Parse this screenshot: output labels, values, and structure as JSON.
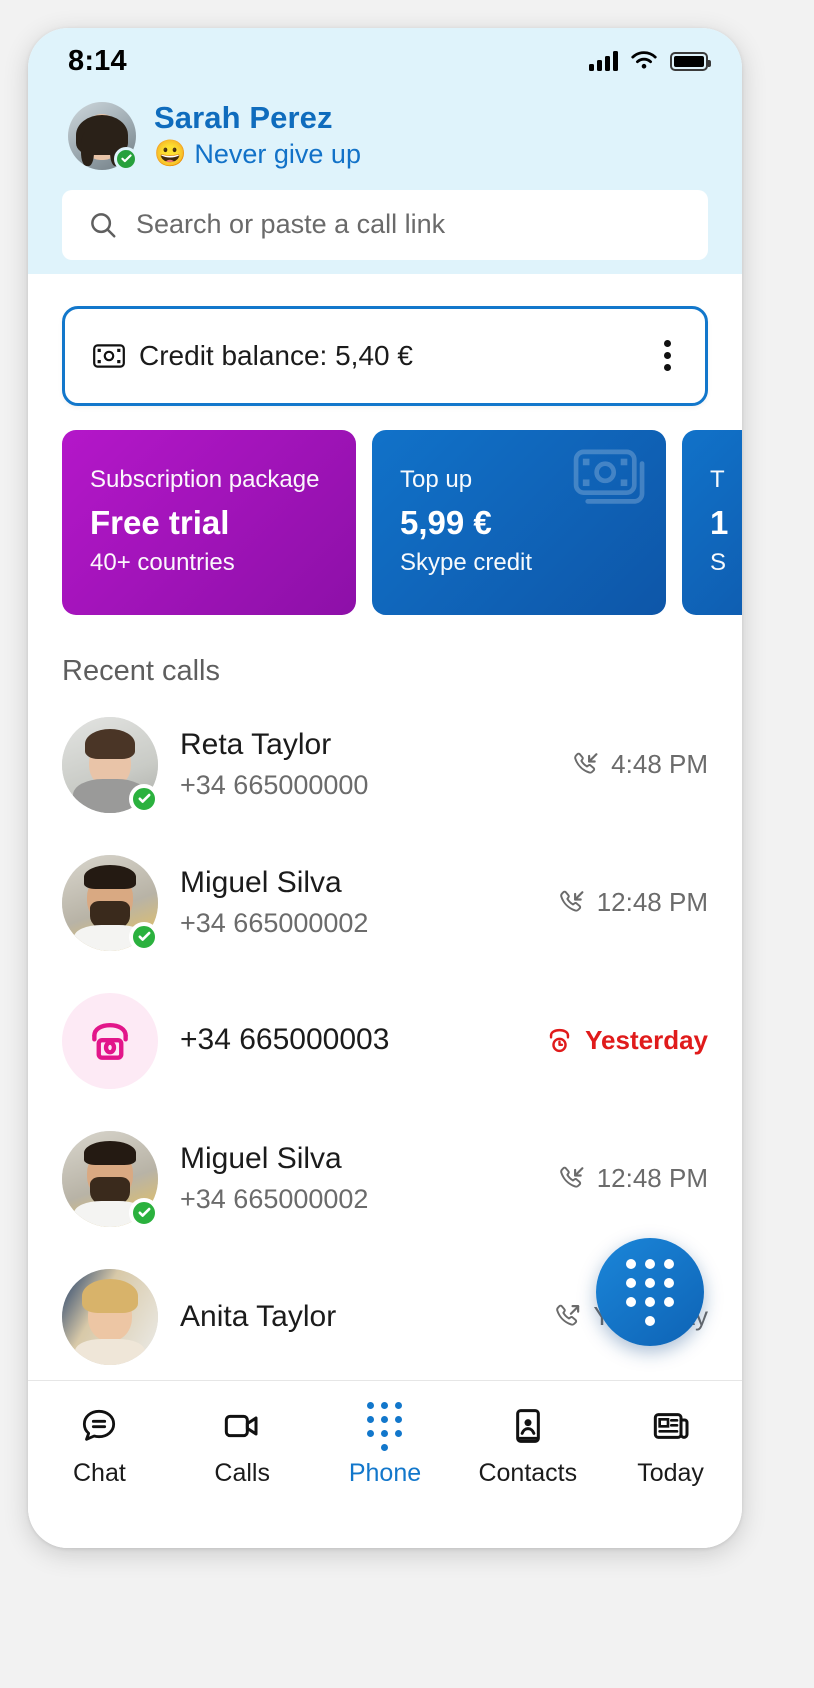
{
  "status_bar": {
    "time": "8:14",
    "signal_icon": "cellular-bars-icon",
    "wifi_icon": "wifi-icon",
    "battery_icon": "battery-full-icon"
  },
  "profile": {
    "name": "Sarah Perez",
    "mood_emoji": "😀",
    "mood_text": "Never give up",
    "presence": "available",
    "avatar_name": "profile-avatar"
  },
  "search": {
    "placeholder": "Search or paste a call link",
    "value": "",
    "icon": "search-icon"
  },
  "credit": {
    "label": "Credit balance: 5,40 €",
    "icon": "banknote-icon",
    "menu_icon": "more-vertical-icon"
  },
  "promo_cards": [
    {
      "top": "Subscription package",
      "mid": "Free trial",
      "bottom": "40+ countries",
      "color": "#a813bf",
      "kind": "purple"
    },
    {
      "top": "Top up",
      "mid": "5,99 €",
      "bottom": "Skype credit",
      "color": "#1070c5",
      "kind": "blue"
    },
    {
      "top": "T",
      "mid": "1",
      "bottom": "S",
      "color": "#1070c5",
      "kind": "blue-partial"
    }
  ],
  "recent": {
    "title": "Recent calls",
    "items": [
      {
        "name": "Reta Taylor",
        "number": "+34 665000000",
        "time": "4:48 PM",
        "direction": "incoming",
        "direction_icon": "call-incoming-icon",
        "presence": "available",
        "avatar": "photo"
      },
      {
        "name": "Miguel Silva",
        "number": "+34 665000002",
        "time": "12:48 PM",
        "direction": "incoming",
        "direction_icon": "call-incoming-icon",
        "presence": "available",
        "avatar": "photo"
      },
      {
        "name": "",
        "number": "+34 665000003",
        "time": "Yesterday",
        "direction": "missed",
        "direction_icon": "call-missed-icon",
        "presence": "none",
        "avatar": "pink-phone"
      },
      {
        "name": "Miguel Silva",
        "number": "+34 665000002",
        "time": "12:48 PM",
        "direction": "incoming",
        "direction_icon": "call-incoming-icon",
        "presence": "available",
        "avatar": "photo"
      },
      {
        "name": "Anita Taylor",
        "number": "",
        "time": "Yesterday",
        "direction": "outgoing",
        "direction_icon": "call-outgoing-icon",
        "presence": "none",
        "avatar": "photo"
      }
    ]
  },
  "fab": {
    "name": "dialpad-button",
    "icon": "dialpad-icon"
  },
  "tabs": [
    {
      "label": "Chat",
      "icon": "chat-bubble-icon",
      "active": false
    },
    {
      "label": "Calls",
      "icon": "video-camera-icon",
      "active": false
    },
    {
      "label": "Phone",
      "icon": "dialpad-icon",
      "active": true
    },
    {
      "label": "Contacts",
      "icon": "contact-card-icon",
      "active": false
    },
    {
      "label": "Today",
      "icon": "news-icon",
      "active": false
    }
  ],
  "colors": {
    "accent": "#1277cb",
    "header_bg": "#dff3fb",
    "missed": "#e01b1b",
    "purple": "#a813bf",
    "presence_green": "#2bb13e"
  }
}
